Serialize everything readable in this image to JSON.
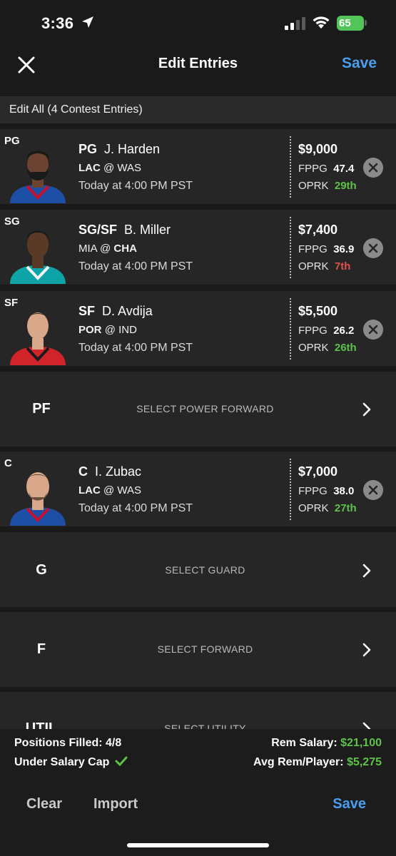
{
  "status": {
    "time": "3:36",
    "battery": "65"
  },
  "nav": {
    "title": "Edit Entries",
    "save": "Save"
  },
  "edit_all": "Edit All (4 Contest Entries)",
  "players": [
    {
      "slot": "PG",
      "pos": "PG",
      "name": "J. Harden",
      "team": "LAC",
      "at": "@",
      "opp": "WAS",
      "team_bold": true,
      "opp_bold": false,
      "time": "Today at 4:00 PM PST",
      "salary": "$9,000",
      "fppg_label": "FPPG",
      "fppg": "47.4",
      "oprk_label": "OPRK",
      "oprk": "29th",
      "oprk_status": "good",
      "jersey_color": "#1d4fa6",
      "trim": "#c8102e",
      "skin": "#6b4330",
      "hair": "#1a1a1a"
    },
    {
      "slot": "SG",
      "pos": "SG/SF",
      "name": "B. Miller",
      "team": "MIA",
      "at": "@",
      "opp": "CHA",
      "team_bold": false,
      "opp_bold": true,
      "time": "Today at 4:00 PM PST",
      "salary": "$7,400",
      "fppg_label": "FPPG",
      "fppg": "36.9",
      "oprk_label": "OPRK",
      "oprk": "7th",
      "oprk_status": "bad",
      "jersey_color": "#0ea3a6",
      "trim": "#f4f4f4",
      "skin": "#5a3a26",
      "hair": "#1a1a1a"
    },
    {
      "slot": "SF",
      "pos": "SF",
      "name": "D. Avdija",
      "team": "POR",
      "at": "@",
      "opp": "IND",
      "team_bold": true,
      "opp_bold": false,
      "time": "Today at 4:00 PM PST",
      "salary": "$5,500",
      "fppg_label": "FPPG",
      "fppg": "26.2",
      "oprk_label": "OPRK",
      "oprk": "26th",
      "oprk_status": "good",
      "jersey_color": "#d1232a",
      "trim": "#1a1a1a",
      "skin": "#d9a88a",
      "hair": "#3a2a20"
    },
    {
      "slot": "C",
      "pos": "C",
      "name": "I. Zubac",
      "team": "LAC",
      "at": "@",
      "opp": "WAS",
      "team_bold": true,
      "opp_bold": false,
      "time": "Today at 4:00 PM PST",
      "salary": "$7,000",
      "fppg_label": "FPPG",
      "fppg": "38.0",
      "oprk_label": "OPRK",
      "oprk": "27th",
      "oprk_status": "good",
      "jersey_color": "#1d4fa6",
      "trim": "#c8102e",
      "skin": "#d9a88a",
      "hair": "#3a2a20"
    }
  ],
  "empty_slots": [
    {
      "pos": "PF",
      "label": "SELECT POWER FORWARD"
    },
    {
      "pos": "G",
      "label": "SELECT GUARD"
    },
    {
      "pos": "F",
      "label": "SELECT FORWARD"
    },
    {
      "pos": "UTIL",
      "label": "SELECT UTILITY"
    }
  ],
  "summary": {
    "positions_label": "Positions Filled:",
    "positions_value": "4/8",
    "cap_label": "Under Salary Cap",
    "rem_label": "Rem Salary:",
    "rem_value": "$21,100",
    "avg_label": "Avg Rem/Player:",
    "avg_value": "$5,275"
  },
  "actions": {
    "clear": "Clear",
    "import": "Import",
    "save": "Save"
  },
  "colors": {
    "accent": "#4a9eef",
    "good": "#5ec24a",
    "bad": "#e0524a"
  }
}
